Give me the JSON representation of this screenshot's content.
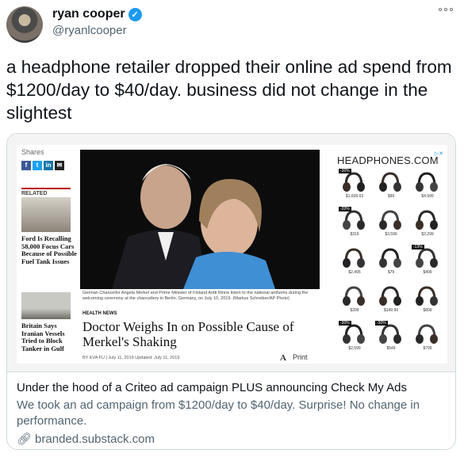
{
  "tweet": {
    "author_name": "ryan cooper",
    "handle": "@ryanlcooper",
    "text": "a headphone retailer dropped their online ad spend from $1200/day to $40/day. business did not change in the slightest"
  },
  "card": {
    "title": "Under the hood of a Criteo ad campaign PLUS announcing Check My Ads",
    "description": "We took an ad campaign from $1200/day to $40/day. Surprise! No change in performance.",
    "link": "branded.substack.com",
    "image": {
      "shares_label": "Shares",
      "related_label": "RELATED",
      "related_1": "Ford Is Recalling 58,000 Focus Cars Because of Possible Fuel Tank Issues",
      "related_2": "Britain Says Iranian Vessels Tried to Block Tanker in Gulf",
      "caption": "German Chancellor Angela Merkel and Prime Minister of Finland Antti Rinne listen to the national anthems during the welcoming ceremony at the chancellery in Berlin, Germany, on July 10, 2019. (Markus Schreiber/AP Photo)",
      "kicker": "HEALTH NEWS",
      "headline": "Doctor Weighs In on Possible Cause of Merkel's Shaking",
      "byline": "BY EVA FU  |  July 11, 2019  Updated: July 11, 2019",
      "print_label": "Print",
      "font_tool": "A",
      "ad_brand": "HEADPHONES.COM",
      "ad_prices": [
        "$1,609.03",
        "$99",
        "$4,999",
        "$319",
        "$3,599",
        "$2,299",
        "$2,495",
        "$79",
        "$499",
        "$399",
        "$149.99",
        "$899",
        "$2,599",
        "$549",
        "$799"
      ],
      "ad_badges": [
        "-30%",
        "-20%",
        "-13%",
        "-30%",
        "-30%"
      ]
    }
  }
}
